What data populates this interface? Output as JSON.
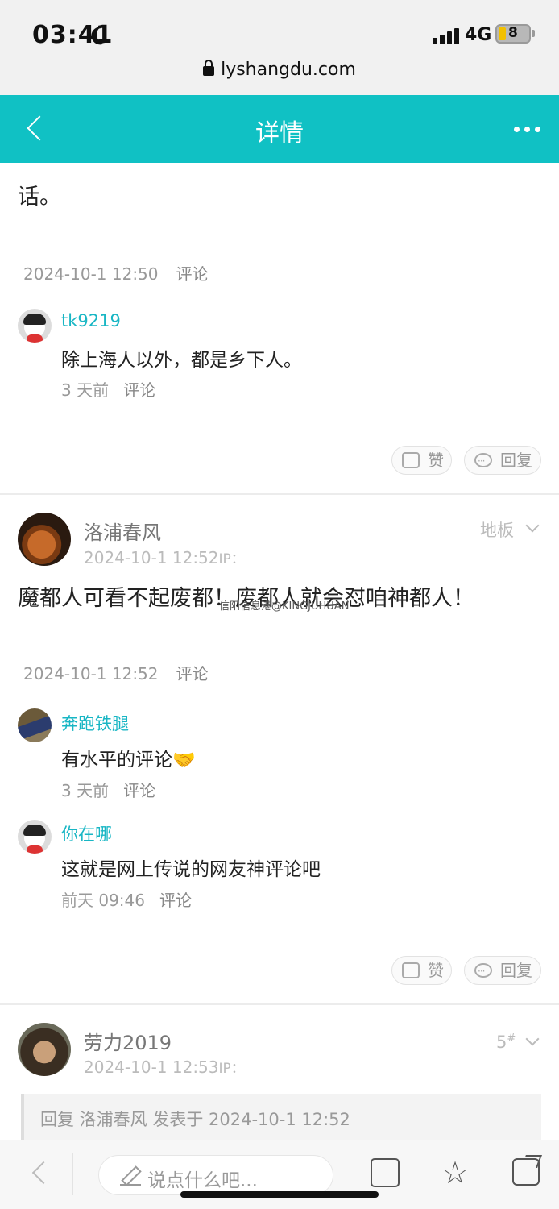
{
  "status": {
    "time": "03:41",
    "network": "4G",
    "battery": "8",
    "url": "lyshangdu.com"
  },
  "header": {
    "title": "详情"
  },
  "clipped_text": "话。",
  "post1": {
    "date": "2024-10-1 12:50",
    "comment_label": "评论"
  },
  "reply1": {
    "user": "tk9219",
    "text": "除上海人以外，都是乡下人。",
    "time": "3 天前",
    "comment_label": "评论"
  },
  "actions1": {
    "like": "赞",
    "reply": "回复"
  },
  "post2": {
    "author": "洛浦春风",
    "date": "2024-10-1 12:52",
    "ip_label": "IP：",
    "floor": "地板",
    "text": "魔都人可看不起废都！废都人就会怼咱神都人！",
    "watermark": "信阳信息港@KINGJUHUAN",
    "footer_date": "2024-10-1 12:52",
    "comment_label": "评论"
  },
  "reply2": {
    "user": "奔跑铁腿",
    "text": "有水平的评论",
    "emoji": "🤝",
    "time": "3 天前",
    "comment_label": "评论"
  },
  "reply3": {
    "user": "你在哪",
    "text": "这就是网上传说的网友神评论吧",
    "time": "前天 09:46",
    "comment_label": "评论"
  },
  "actions2": {
    "like": "赞",
    "reply": "回复"
  },
  "post3": {
    "author": "劳力2019",
    "date": "2024-10-1 12:53",
    "ip_label": "IP：",
    "floor": "5",
    "floor_sup": "#",
    "quote": "回复 洛浦春风 发表于 2024-10-1 12:52"
  },
  "bottom": {
    "placeholder": "说点什么吧..."
  }
}
